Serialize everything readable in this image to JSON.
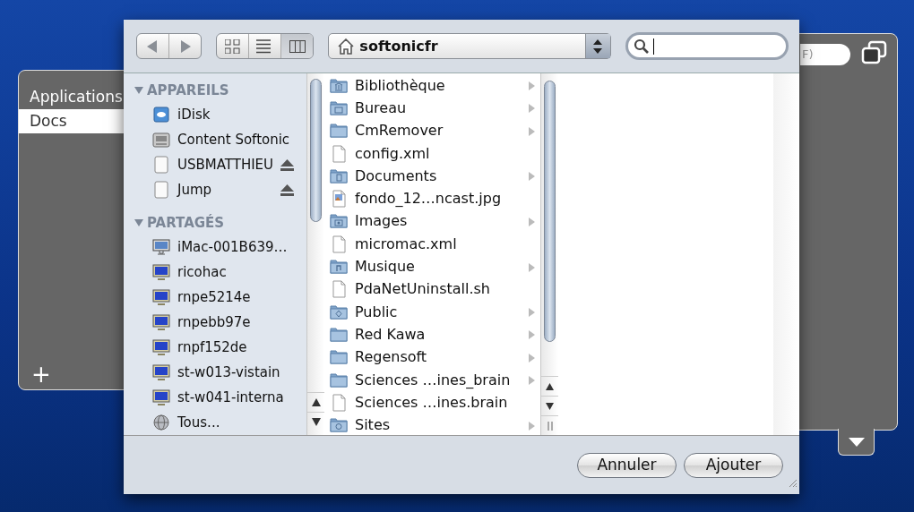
{
  "left_panel": {
    "items": [
      {
        "label": "Applications",
        "selected": false
      },
      {
        "label": "Docs",
        "selected": true
      }
    ],
    "add_button": "+"
  },
  "right_panel": {
    "search_fragment": "F)"
  },
  "dialog": {
    "toolbar": {
      "views": [
        {
          "kind": "icons",
          "selected": false
        },
        {
          "kind": "list",
          "selected": false
        },
        {
          "kind": "columns",
          "selected": true
        }
      ],
      "location": "softonicfr"
    },
    "sidebar": [
      {
        "title": "APPAREILS",
        "expanded": true,
        "items": [
          {
            "label": "iDisk",
            "kind": "idisk",
            "ejectable": false
          },
          {
            "label": "Content Softonic",
            "kind": "harddisk",
            "ejectable": false
          },
          {
            "label": "USBMATTHIEU",
            "kind": "drive",
            "ejectable": true
          },
          {
            "label": "Jump",
            "kind": "drive",
            "ejectable": true
          }
        ]
      },
      {
        "title": "PARTAGÉS",
        "expanded": true,
        "items": [
          {
            "label": "iMac-001B639…",
            "kind": "imac",
            "ejectable": false
          },
          {
            "label": "ricohac",
            "kind": "monitor",
            "ejectable": false
          },
          {
            "label": "rnpe5214e",
            "kind": "monitor",
            "ejectable": false
          },
          {
            "label": "rnpebb97e",
            "kind": "monitor",
            "ejectable": false
          },
          {
            "label": "rnpf152de",
            "kind": "monitor",
            "ejectable": false
          },
          {
            "label": "st-w013-vistain",
            "kind": "monitor",
            "ejectable": false
          },
          {
            "label": "st-w041-interna",
            "kind": "monitor",
            "ejectable": false
          },
          {
            "label": "Tous...",
            "kind": "network",
            "ejectable": false
          }
        ]
      }
    ],
    "files": [
      {
        "name": "Bibliothèque",
        "kind": "library",
        "expandable": true
      },
      {
        "name": "Bureau",
        "kind": "desktop",
        "expandable": true
      },
      {
        "name": "CmRemover",
        "kind": "folder",
        "expandable": true
      },
      {
        "name": "config.xml",
        "kind": "file",
        "expandable": false
      },
      {
        "name": "Documents",
        "kind": "documents",
        "expandable": true
      },
      {
        "name": "fondo_12…ncast.jpg",
        "kind": "image",
        "expandable": false
      },
      {
        "name": "Images",
        "kind": "pictures",
        "expandable": true
      },
      {
        "name": "micromac.xml",
        "kind": "file",
        "expandable": false
      },
      {
        "name": "Musique",
        "kind": "music",
        "expandable": true
      },
      {
        "name": "PdaNetUninstall.sh",
        "kind": "file",
        "expandable": false
      },
      {
        "name": "Public",
        "kind": "public",
        "expandable": true
      },
      {
        "name": "Red Kawa",
        "kind": "folder",
        "expandable": true
      },
      {
        "name": "Regensoft",
        "kind": "folder",
        "expandable": true
      },
      {
        "name": "Sciences …ines_brain",
        "kind": "folder",
        "expandable": true
      },
      {
        "name": "Sciences …ines.brain",
        "kind": "file",
        "expandable": false
      },
      {
        "name": "Sites",
        "kind": "sites",
        "expandable": true
      }
    ],
    "buttons": [
      {
        "label": "Annuler"
      },
      {
        "label": "Ajouter"
      }
    ]
  }
}
